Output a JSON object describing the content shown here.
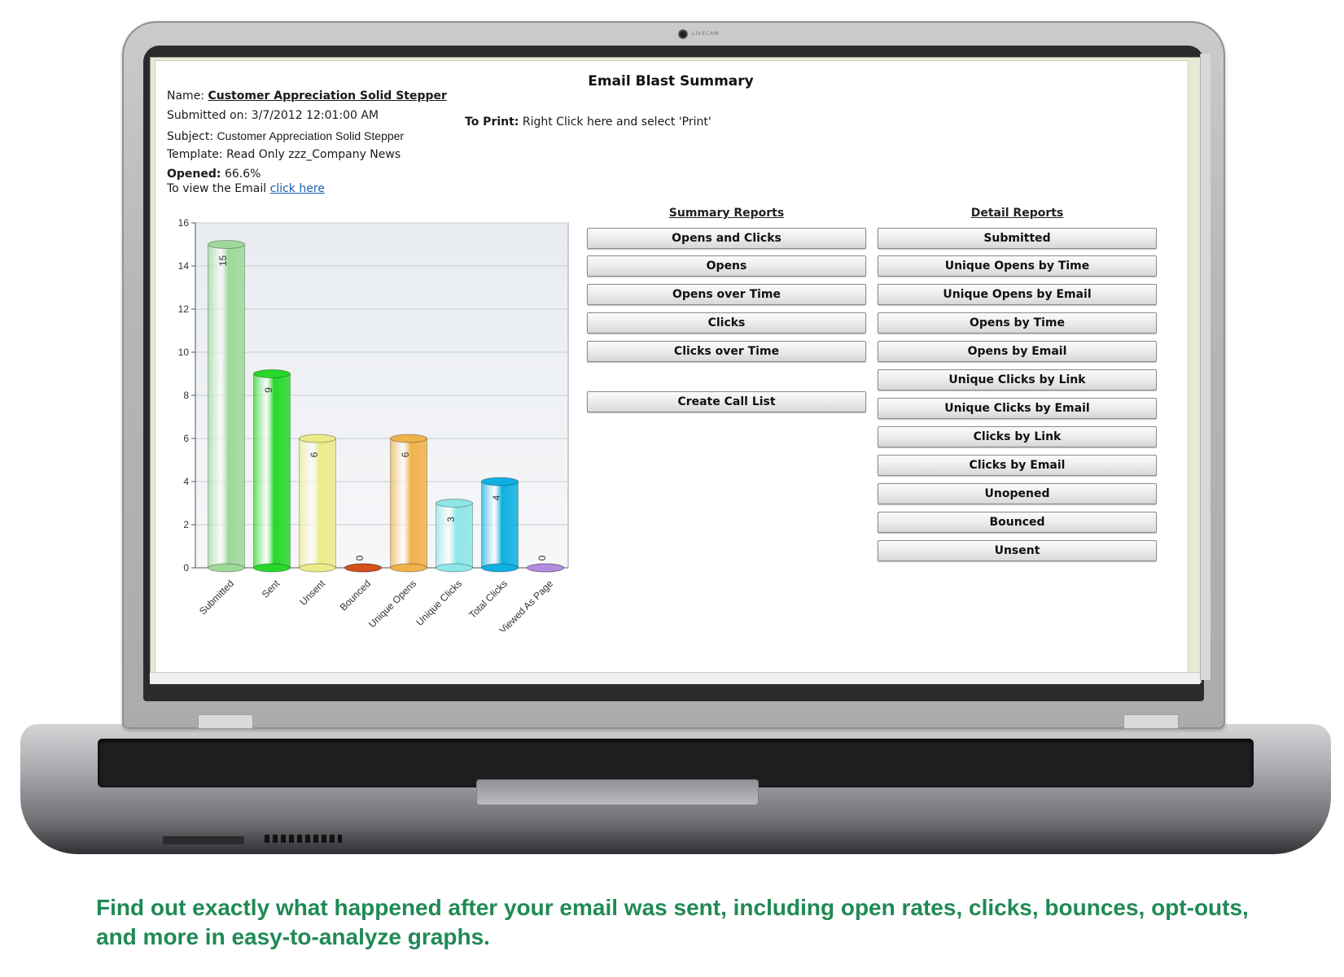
{
  "window": {
    "camera_label": "LIVECAM"
  },
  "page": {
    "title": "Email Blast Summary",
    "name_label": "Name:",
    "name_value": "Customer Appreciation Solid Stepper",
    "submitted_label": "Submitted on:",
    "submitted_value": "3/7/2012 12:01:00 AM",
    "subject_label": "Subject:",
    "subject_value": "Customer Appreciation Solid Stepper",
    "template_label": "Template:",
    "template_value": "Read Only zzz_Company News",
    "opened_label": "Opened:",
    "opened_value": "66.6%",
    "view_email_text": "To view the Email",
    "view_email_link": "click here",
    "print_label": "To Print:",
    "print_text": "Right Click here and select 'Print'"
  },
  "summary_reports": {
    "heading": "Summary Reports",
    "buttons": [
      "Opens and Clicks",
      "Opens",
      "Opens over Time",
      "Clicks",
      "Clicks over Time"
    ],
    "call_list_button": "Create Call List"
  },
  "detail_reports": {
    "heading": "Detail Reports",
    "buttons": [
      "Submitted",
      "Unique Opens by Time",
      "Unique Opens by Email",
      "Opens by Time",
      "Opens by Email",
      "Unique Clicks by Link",
      "Unique Clicks by Email",
      "Clicks by Link",
      "Clicks by Email",
      "Unopened",
      "Bounced",
      "Unsent"
    ]
  },
  "chart_data": {
    "type": "bar",
    "categories": [
      "Submitted",
      "Sent",
      "Unsent",
      "Bounced",
      "Unique Opens",
      "Unique Clicks",
      "Total Clicks",
      "Viewed As Page"
    ],
    "values": [
      15,
      9,
      6,
      0,
      6,
      3,
      4,
      0
    ],
    "colors": [
      "#9ed99a",
      "#27d82b",
      "#eceb8a",
      "#d4501c",
      "#f0b24a",
      "#8ee6e6",
      "#0fb0e0",
      "#b58be0"
    ],
    "ylim": [
      0,
      16
    ],
    "yticks": [
      0,
      2,
      4,
      6,
      8,
      10,
      12,
      14,
      16
    ],
    "grid": true,
    "title": "",
    "xlabel": "",
    "ylabel": ""
  },
  "caption": "Find out exactly what happened after your email was sent, including open rates, clicks, bounces, opt-outs, and more in easy-to-analyze graphs."
}
